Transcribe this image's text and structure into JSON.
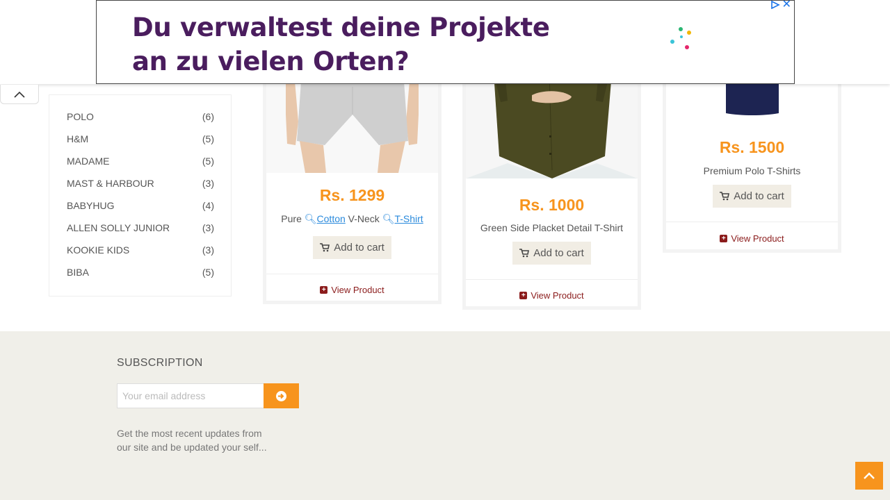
{
  "ad": {
    "headline_line1": "Du verwaltest deine Projekte",
    "headline_line2": "an zu vielen Orten?",
    "close_symbol": "✕",
    "dot_colors": [
      "#f2b705",
      "#2bb673",
      "#3bc4d8",
      "#e5266b"
    ]
  },
  "sidebar": {
    "brands": [
      {
        "name": "POLO",
        "count": "(6)"
      },
      {
        "name": "H&M",
        "count": "(5)"
      },
      {
        "name": "MADAME",
        "count": "(5)"
      },
      {
        "name": "MAST & HARBOUR",
        "count": "(3)"
      },
      {
        "name": "BABYHUG",
        "count": "(4)"
      },
      {
        "name": "ALLEN SOLLY JUNIOR",
        "count": "(3)"
      },
      {
        "name": "KOOKIE KIDS",
        "count": "(3)"
      },
      {
        "name": "BIBA",
        "count": "(5)"
      }
    ]
  },
  "products": [
    {
      "price": "Rs. 1299",
      "name_parts": [
        "Pure",
        "Cotton",
        "V-Neck",
        "T-Shirt"
      ],
      "add_to_cart": "Add to cart",
      "view_product": "View Product"
    },
    {
      "price": "Rs. 1000",
      "name": "Green Side Placket Detail T-Shirt",
      "add_to_cart": "Add to cart",
      "view_product": "View Product"
    },
    {
      "price": "Rs. 1500",
      "name": "Premium Polo T-Shirts",
      "add_to_cart": "Add to cart",
      "view_product": "View Product"
    }
  ],
  "footer": {
    "subscription_title": "SUBSCRIPTION",
    "email_placeholder": "Your email address",
    "description_line1": "Get the most recent updates from",
    "description_line2": "our site and be updated your self..."
  },
  "colors": {
    "accent": "#f7941d",
    "view_product": "#8b1c1c",
    "footer_bg": "#f0efe9",
    "ad_text": "#4a1d5e"
  }
}
